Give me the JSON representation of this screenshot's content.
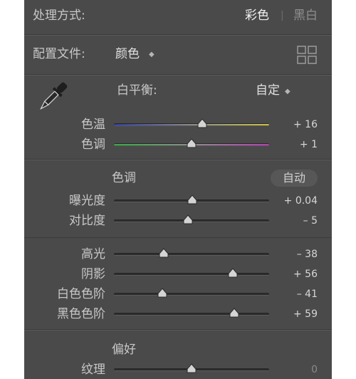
{
  "treatment": {
    "label": "处理方式:",
    "color": "彩色",
    "divider": "|",
    "bw": "黑白"
  },
  "profile": {
    "label": "配置文件:",
    "value": "颜色",
    "arrow": "◆",
    "browse_icon": "grid-icon"
  },
  "white_balance": {
    "eyedropper_icon": "eyedropper-icon",
    "label": "白平衡:",
    "value": "自定",
    "arrow": "◆",
    "sliders": [
      {
        "label": "色温",
        "value": "+ 16",
        "position": 0.57,
        "track": "temp"
      },
      {
        "label": "色调",
        "value": "+ 1",
        "position": 0.5,
        "track": "tint"
      }
    ]
  },
  "tone": {
    "title": "色调",
    "auto": "自动",
    "sliders": [
      {
        "label": "曝光度",
        "value": "+ 0.04",
        "position": 0.505
      },
      {
        "label": "对比度",
        "value": "– 5",
        "position": 0.475
      }
    ]
  },
  "tone2": {
    "sliders": [
      {
        "label": "高光",
        "value": "– 38",
        "position": 0.32
      },
      {
        "label": "阴影",
        "value": "+ 56",
        "position": 0.765
      },
      {
        "label": "白色色阶",
        "value": "– 41",
        "position": 0.31
      },
      {
        "label": "黑色色阶",
        "value": "+ 59",
        "position": 0.775
      }
    ]
  },
  "presence": {
    "title": "偏好",
    "sliders": [
      {
        "label": "纹理",
        "value": "0",
        "position": 0.5
      }
    ]
  },
  "colors": {
    "panel_bg": "#4a4a4a",
    "temp_gradient": [
      "#2f3aa8",
      "#8a8a8a",
      "#c9c23c"
    ],
    "tint_gradient": [
      "#2fae3a",
      "#8a8a8a",
      "#b93bb9"
    ]
  }
}
